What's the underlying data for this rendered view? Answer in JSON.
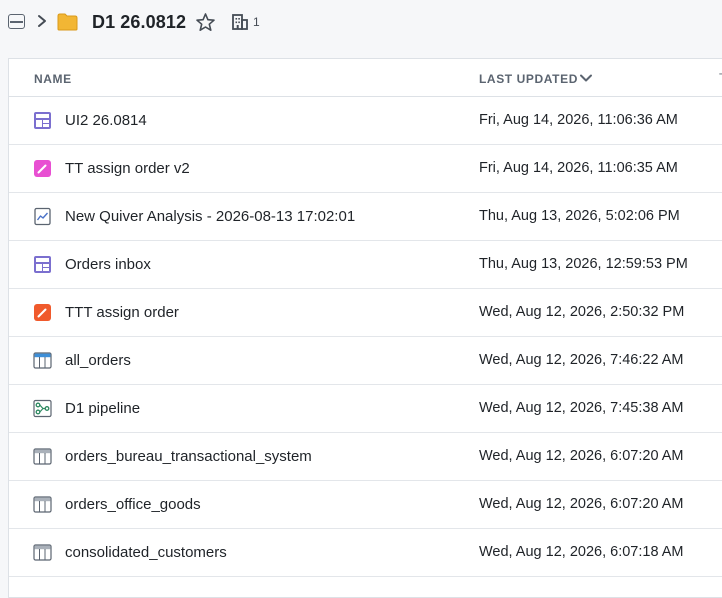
{
  "header": {
    "title": "D1 26.0812",
    "member_count": "1",
    "icons": [
      "sidebar-toggle-icon",
      "chevron-right-icon",
      "folder-icon",
      "star-icon",
      "building-icon"
    ]
  },
  "columns": {
    "name": "NAME",
    "last_updated": "LAST UPDATED",
    "sort_direction": "descending"
  },
  "rows": [
    {
      "name": "UI2 26.0814",
      "updated": "Fri, Aug 14, 2026, 11:06:36 AM",
      "icon": "workshop-app-icon"
    },
    {
      "name": "TT assign order v2",
      "updated": "Fri, Aug 14, 2026, 11:06:35 AM",
      "icon": "pink-action-icon"
    },
    {
      "name": "New Quiver Analysis - 2026-08-13 17:02:01",
      "updated": "Thu, Aug 13, 2026, 5:02:06 PM",
      "icon": "analysis-chart-icon"
    },
    {
      "name": "Orders inbox",
      "updated": "Thu, Aug 13, 2026, 12:59:53 PM",
      "icon": "workshop-app-icon"
    },
    {
      "name": "TTT assign order",
      "updated": "Wed, Aug 12, 2026, 2:50:32 PM",
      "icon": "orange-action-icon"
    },
    {
      "name": "all_orders",
      "updated": "Wed, Aug 12, 2026, 7:46:22 AM",
      "icon": "dataset-blue-icon"
    },
    {
      "name": "D1 pipeline",
      "updated": "Wed, Aug 12, 2026, 7:45:38 AM",
      "icon": "pipeline-icon"
    },
    {
      "name": "orders_bureau_transactional_system",
      "updated": "Wed, Aug 12, 2026, 6:07:20 AM",
      "icon": "dataset-gray-icon"
    },
    {
      "name": "orders_office_goods",
      "updated": "Wed, Aug 12, 2026, 6:07:20 AM",
      "icon": "dataset-gray-icon"
    },
    {
      "name": "consolidated_customers",
      "updated": "Wed, Aug 12, 2026, 6:07:18 AM",
      "icon": "dataset-gray-icon"
    }
  ],
  "colors": {
    "folder": "#f2b634",
    "pink_action": "#e84fd2",
    "orange_action": "#f05a2c",
    "workshop_purple": "#7b6fcf",
    "dataset_blue": "#3d8fd8",
    "pipeline_green": "#2f8a62"
  }
}
